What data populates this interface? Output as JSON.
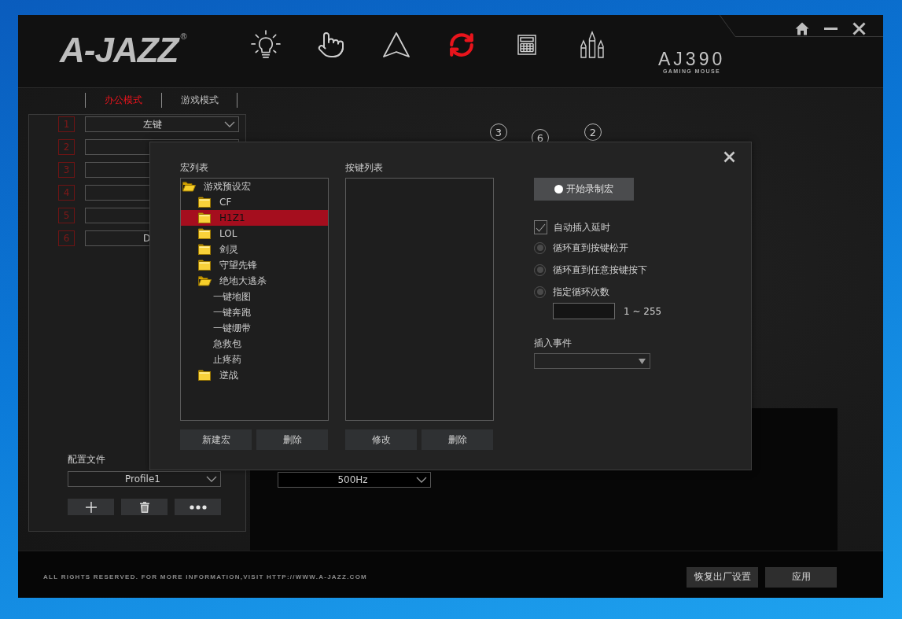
{
  "header": {
    "logo": {
      "text": "A-JAZZ",
      "mark": "®"
    },
    "nav": [
      {
        "kind": "bulb",
        "selected": false
      },
      {
        "kind": "hand",
        "selected": false
      },
      {
        "kind": "triangle",
        "selected": false
      },
      {
        "kind": "sync",
        "selected": true
      },
      {
        "kind": "calculator",
        "selected": false
      },
      {
        "kind": "bullets",
        "selected": false
      }
    ],
    "product": {
      "model": "AJ390",
      "subtitle": "GAMING MOUSE"
    }
  },
  "mode_tabs": [
    {
      "label": "办公模式",
      "selected": true
    },
    {
      "label": "游戏模式",
      "selected": false
    }
  ],
  "button_rows": [
    {
      "number": "1",
      "value": "左键"
    },
    {
      "number": "2"
    },
    {
      "number": "3"
    },
    {
      "number": "4"
    },
    {
      "number": "5"
    },
    {
      "number": "6",
      "value": "D"
    }
  ],
  "profile": {
    "label": "配置文件",
    "value": "Profile1"
  },
  "callouts": [
    "3",
    "6",
    "2"
  ],
  "polling": {
    "value": "500Hz"
  },
  "macro_dialog": {
    "macro_list": {
      "label": "宏列表",
      "tree": [
        {
          "kind": "folder",
          "label": "游戏预设宏",
          "expanded": true,
          "selected": false,
          "children": [
            {
              "kind": "folder",
              "label": "CF",
              "expanded": false,
              "selected": false
            },
            {
              "kind": "folder",
              "label": "H1Z1",
              "expanded": false,
              "selected": true
            },
            {
              "kind": "folder",
              "label": "LOL",
              "expanded": false,
              "selected": false
            },
            {
              "kind": "folder",
              "label": "剑灵",
              "expanded": false,
              "selected": false
            },
            {
              "kind": "folder",
              "label": "守望先锋",
              "expanded": false,
              "selected": false
            },
            {
              "kind": "folder",
              "label": "绝地大逃杀",
              "expanded": true,
              "selected": false,
              "children": [
                {
                  "kind": "macro",
                  "label": "一键地图",
                  "selected": false
                },
                {
                  "kind": "macro",
                  "label": "一键奔跑",
                  "selected": false
                },
                {
                  "kind": "macro",
                  "label": "一键绷带",
                  "selected": false
                },
                {
                  "kind": "macro",
                  "label": "急救包",
                  "selected": false
                },
                {
                  "kind": "macro",
                  "label": "止疼药",
                  "selected": false
                }
              ]
            },
            {
              "kind": "folder",
              "label": "逆战",
              "expanded": false,
              "selected": false
            }
          ]
        }
      ],
      "buttons": [
        "新建宏",
        "删除"
      ]
    },
    "key_list": {
      "label": "按键列表",
      "buttons": [
        "修改",
        "删除"
      ]
    },
    "record_button": "开始录制宏",
    "auto_delay": {
      "label": "自动插入延时",
      "checked": true
    },
    "loop_options": [
      {
        "label": "循环直到按键松开",
        "selected": false
      },
      {
        "label": "循环直到任意按键按下",
        "selected": false
      },
      {
        "label": "指定循环次数",
        "selected": false
      }
    ],
    "loop_count": {
      "range": "1 ~ 255"
    },
    "insert_event": {
      "label": "插入事件"
    }
  },
  "footer": {
    "copyright": "ALL RIGHTS RESERVED. FOR MORE INFORMATION,VISIT HTTP://WWW.A-JAZZ.COM",
    "buttons": [
      "恢复出厂设置",
      "应用"
    ]
  }
}
